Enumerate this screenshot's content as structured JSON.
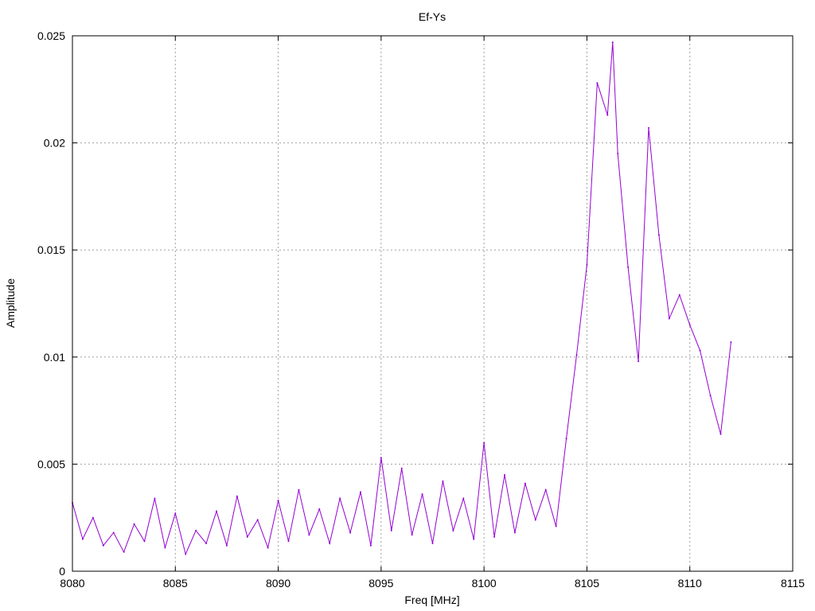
{
  "chart_data": {
    "type": "line",
    "title": "Ef-Ys",
    "xlabel": "Freq [MHz]",
    "ylabel": "Amplitude",
    "xlim": [
      8080,
      8115
    ],
    "ylim": [
      0,
      0.025
    ],
    "x_ticks": [
      8080,
      8085,
      8090,
      8095,
      8100,
      8105,
      8110,
      8115
    ],
    "x_tick_labels": [
      "8080",
      "8085",
      "8090",
      "8095",
      "8100",
      "8105",
      "8110",
      "8115"
    ],
    "y_ticks": [
      0,
      0.005,
      0.01,
      0.015,
      0.02,
      0.025
    ],
    "y_tick_labels": [
      "0",
      "0.005",
      "0.01",
      "0.015",
      "0.02",
      "0.025"
    ],
    "grid": true,
    "series": [
      {
        "color": "#9400d3",
        "x": [
          8080,
          8080.5,
          8081,
          8081.5,
          8082,
          8082.5,
          8083,
          8083.5,
          8084,
          8084.5,
          8085,
          8085.5,
          8086,
          8086.5,
          8087,
          8087.5,
          8088,
          8088.5,
          8089,
          8089.5,
          8090,
          8090.5,
          8091,
          8091.5,
          8092,
          8092.5,
          8093,
          8093.5,
          8094,
          8094.5,
          8095,
          8095.5,
          8096,
          8096.5,
          8097,
          8097.5,
          8098,
          8098.5,
          8099,
          8099.5,
          8100,
          8100.5,
          8101,
          8101.5,
          8102,
          8102.5,
          8103,
          8103.5,
          8104,
          8104.5,
          8105,
          8105.5,
          8106,
          8106.25,
          8106.5,
          8107,
          8107.5,
          8108,
          8108.5,
          8109,
          8109.5,
          8110,
          8110.5,
          8111,
          8111.5,
          8112
        ],
        "y": [
          0.0032,
          0.0015,
          0.0025,
          0.0012,
          0.0018,
          0.0009,
          0.0022,
          0.0014,
          0.0034,
          0.0011,
          0.0027,
          0.0008,
          0.0019,
          0.0013,
          0.0028,
          0.0012,
          0.0035,
          0.0016,
          0.0024,
          0.0011,
          0.0033,
          0.0014,
          0.0038,
          0.0017,
          0.0029,
          0.0013,
          0.0034,
          0.0018,
          0.0037,
          0.0012,
          0.0053,
          0.0019,
          0.0048,
          0.0017,
          0.0036,
          0.0013,
          0.0042,
          0.0019,
          0.0034,
          0.0015,
          0.006,
          0.0016,
          0.0045,
          0.0018,
          0.0041,
          0.0024,
          0.0038,
          0.0021,
          0.0062,
          0.0101,
          0.0143,
          0.0228,
          0.0213,
          0.0247,
          0.0195,
          0.0142,
          0.0098,
          0.0207,
          0.0157,
          0.0118,
          0.0129,
          0.0115,
          0.0103,
          0.0082,
          0.0064,
          0.0107
        ]
      }
    ]
  }
}
